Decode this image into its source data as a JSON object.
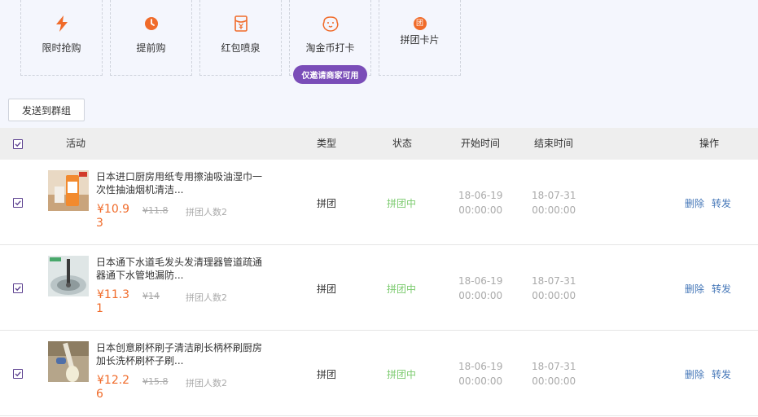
{
  "tools": [
    {
      "label": "限时抢购",
      "icon": "lightning-icon"
    },
    {
      "label": "提前购",
      "icon": "clock-icon"
    },
    {
      "label": "红包喷泉",
      "icon": "red-packet-icon"
    },
    {
      "label": "淘金币打卡",
      "icon": "pig-icon"
    },
    {
      "label": "拼团卡片",
      "icon": "group-badge-icon",
      "icon_char": "团"
    }
  ],
  "badge": "仅邀请商家可用",
  "send_button": "发送到群组",
  "table_headers": {
    "activity": "活动",
    "type": "类型",
    "status": "状态",
    "start": "开始时间",
    "end": "结束时间",
    "ops": "操作"
  },
  "rows": [
    {
      "title": "日本进口厨房用纸专用擦油吸油湿巾一次性抽油烟机清洁...",
      "price": "¥10.9",
      "old_price": "¥11.8",
      "people_label": "拼团人数2",
      "people_cont": "3",
      "type": "拼团",
      "status": "拼团中",
      "start_date": "18-06-19",
      "start_time": "00:00:00",
      "end_date": "18-07-31",
      "end_time": "00:00:00",
      "delete": "删除",
      "forward": "转发"
    },
    {
      "title": "日本通下水道毛发头发清理器管道疏通器通下水管地漏防...",
      "price": "¥11.3",
      "old_price": "¥14",
      "people_label": "拼团人数2",
      "people_cont": "1",
      "type": "拼团",
      "status": "拼团中",
      "start_date": "18-06-19",
      "start_time": "00:00:00",
      "end_date": "18-07-31",
      "end_time": "00:00:00",
      "delete": "删除",
      "forward": "转发"
    },
    {
      "title": "日本创意刷杯刷子清洁刷长柄杯刷厨房加长洗杯刷杯子刷...",
      "price": "¥12.2",
      "old_price": "¥15.8",
      "people_label": "拼团人数2",
      "people_cont": "6",
      "type": "拼团",
      "status": "拼团中",
      "start_date": "18-06-19",
      "start_time": "00:00:00",
      "end_date": "18-07-31",
      "end_time": "00:00:00",
      "delete": "删除",
      "forward": "转发"
    }
  ],
  "colors": {
    "accent_orange": "#f06b2a",
    "badge_purple": "#7a4db8",
    "status_green": "#7ccb6f",
    "link_blue": "#4577b8"
  }
}
